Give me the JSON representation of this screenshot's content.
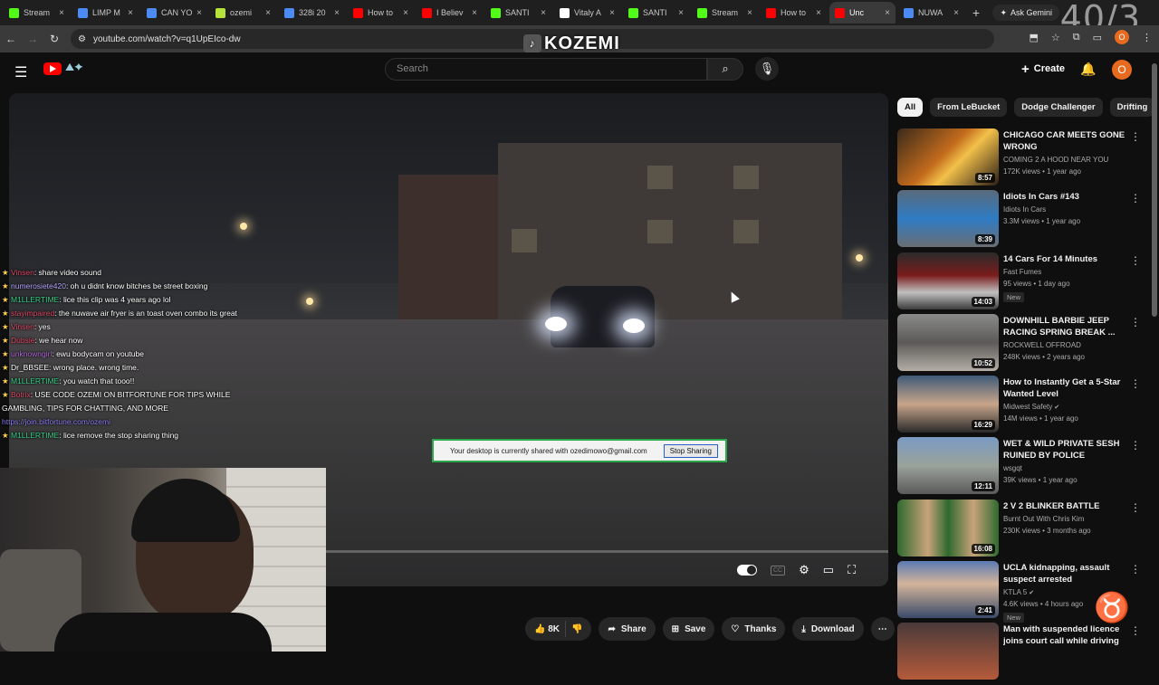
{
  "browser": {
    "tabs": [
      {
        "title": "Stream",
        "color": "#53fc18",
        "active": false
      },
      {
        "title": "LIMP M",
        "color": "#4c8bf5",
        "active": false
      },
      {
        "title": "CAN YO",
        "color": "#4c8bf5",
        "active": false
      },
      {
        "title": "ozemi",
        "color": "#b6e33a",
        "active": false
      },
      {
        "title": "328i 20",
        "color": "#4c8bf5",
        "active": false
      },
      {
        "title": "How to",
        "color": "#ff0000",
        "active": false
      },
      {
        "title": "I Believ",
        "color": "#ff0000",
        "active": false
      },
      {
        "title": "SANTI",
        "color": "#53fc18",
        "active": false
      },
      {
        "title": "Vitaly A",
        "color": "#ffffff",
        "active": false
      },
      {
        "title": "SANTI",
        "color": "#53fc18",
        "active": false
      },
      {
        "title": "Stream",
        "color": "#53fc18",
        "active": false
      },
      {
        "title": "How to",
        "color": "#ff0000",
        "active": false
      },
      {
        "title": "Unc",
        "color": "#ff0000",
        "active": true
      },
      {
        "title": "NUWA",
        "color": "#4c8bf5",
        "active": false
      }
    ],
    "gemini_label": "Ask Gemini",
    "overlay_counter": "40/3",
    "url": "youtube.com/watch?v=q1UpEIco-dw",
    "profile_initial": "O",
    "watermark": "KOZEMI"
  },
  "youtube": {
    "search_placeholder": "Search",
    "create_label": "Create",
    "avatar_initial": "O",
    "accent": "#ff0000"
  },
  "player": {
    "share_notice": "Your desktop is currently shared with ozedimowo@gmail.com",
    "stop_sharing": "Stop Sharing",
    "cc_label": "CC"
  },
  "chat": [
    {
      "user": "Vinsen",
      "user_color": "#e04a6a",
      "text": ": share video sound"
    },
    {
      "user": "numerosiete420",
      "user_color": "#b6a4ff",
      "text": ": oh u didnt know bitches be street boxing"
    },
    {
      "user": "M1LLERTIME",
      "user_color": "#35d08a",
      "text": ": lice this clip was 4 years ago lol"
    },
    {
      "user": "stayimpaired",
      "user_color": "#e04a6a",
      "text": ": the nuwave air fryer is an toast oven combo its great"
    },
    {
      "user": "Vinsen",
      "user_color": "#e04a6a",
      "text": ": yes"
    },
    {
      "user": "Dubsie",
      "user_color": "#e04a6a",
      "text": ": we hear now"
    },
    {
      "user": "unknowngirl",
      "user_color": "#b06ad8",
      "text": ": ewu bodycam on youtube"
    },
    {
      "user": "Dr_BBSEE",
      "user_color": "#ffffff",
      "text": ": wrong place. wrong time."
    },
    {
      "user": "M1LLERTIME",
      "user_color": "#35d08a",
      "text": ": you watch that tooo!!"
    },
    {
      "user": "Botrix",
      "user_color": "#e04a6a",
      "text": ": USE CODE OZEMI ON BITFORTUNE FOR TIPS WHILE"
    },
    {
      "user": "",
      "user_color": "#ffffff",
      "text": "GAMBLING, TIPS FOR CHATTING, AND MORE"
    },
    {
      "user": "",
      "user_color": "#8a7cf0",
      "text": "https://join.bitfortune.com/ozemi"
    },
    {
      "user": "M1LLERTIME",
      "user_color": "#35d08a",
      "text": ": lice remove the stop sharing thing"
    }
  ],
  "actions": {
    "like_count": "8K",
    "share": "Share",
    "save": "Save",
    "thanks": "Thanks",
    "download": "Download"
  },
  "chips": [
    "All",
    "From LeBucket",
    "Dodge Challenger",
    "Drifting"
  ],
  "recommendations": [
    {
      "title": "CHICAGO CAR MEETS GONE WRONG",
      "channel": "COMING 2 A HOOD NEAR YOU",
      "views": "172K views • 1 year ago",
      "duration": "8:57",
      "verified": false,
      "badge": "",
      "thumb": "linear-gradient(135deg,#3a2a1a,#c26a1c 45%,#f2c04a 60%,#2a1e15)"
    },
    {
      "title": "Idiots In Cars #143",
      "channel": "Idiots In Cars",
      "views": "3.3M views • 1 year ago",
      "duration": "8:39",
      "verified": false,
      "badge": "",
      "thumb": "linear-gradient(180deg,#5a6a7a,#2e7bc4 50%,#6a6e72)"
    },
    {
      "title": "14 Cars For 14 Minutes",
      "channel": "Fast Fumes",
      "views": "95 views • 1 day ago",
      "duration": "14:03",
      "verified": false,
      "badge": "New",
      "thumb": "linear-gradient(180deg,#2b2b2b,#7a1c1c 40%,#bfbfbf 70%,#3c3c3c)"
    },
    {
      "title": "DOWNHILL BARBIE JEEP RACING SPRING BREAK ...",
      "channel": "ROCKWELL OFFROAD",
      "views": "248K views • 2 years ago",
      "duration": "10:52",
      "verified": false,
      "badge": "",
      "thumb": "linear-gradient(180deg,#8a8a8a,#5c5a58 50%,#b4aea6)"
    },
    {
      "title": "How to Instantly Get a 5-Star Wanted Level",
      "channel": "Midwest Safety",
      "views": "14M views • 1 year ago",
      "duration": "16:29",
      "verified": true,
      "badge": "",
      "thumb": "linear-gradient(180deg,#3e5a78,#c8a58a 50%,#2a2a2a)"
    },
    {
      "title": "WET & WILD PRIVATE SESH RUINED BY POLICE (DAYTIME ...",
      "channel": "wsgqt",
      "views": "39K views • 1 year ago",
      "duration": "12:11",
      "verified": false,
      "badge": "",
      "thumb": "linear-gradient(180deg,#7a9bc4,#9aa29a 50%,#5a5a5a)"
    },
    {
      "title": "2 V 2 BLINKER BATTLE",
      "channel": "Burnt Out With Chris Kim",
      "views": "230K views • 3 months ago",
      "duration": "16:08",
      "verified": false,
      "badge": "",
      "thumb": "linear-gradient(90deg,#2e6a2e,#c9a27a 30%,#2e6a2e 50%,#c9a27a 75%,#2e6a2e)"
    },
    {
      "title": "UCLA kidnapping, assault suspect arrested",
      "channel": "KTLA 5",
      "views": "4.6K views • 4 hours ago",
      "duration": "2:41",
      "verified": true,
      "badge": "New",
      "thumb": "linear-gradient(180deg,#5a7ab4,#d4b49a 40%,#3a4a6a)"
    },
    {
      "title": "Man with suspended licence joins court call while driving",
      "channel": "",
      "views": "",
      "duration": "",
      "verified": false,
      "badge": "",
      "thumb": "linear-gradient(180deg,#4a3a3a,#b45a3a)"
    }
  ]
}
